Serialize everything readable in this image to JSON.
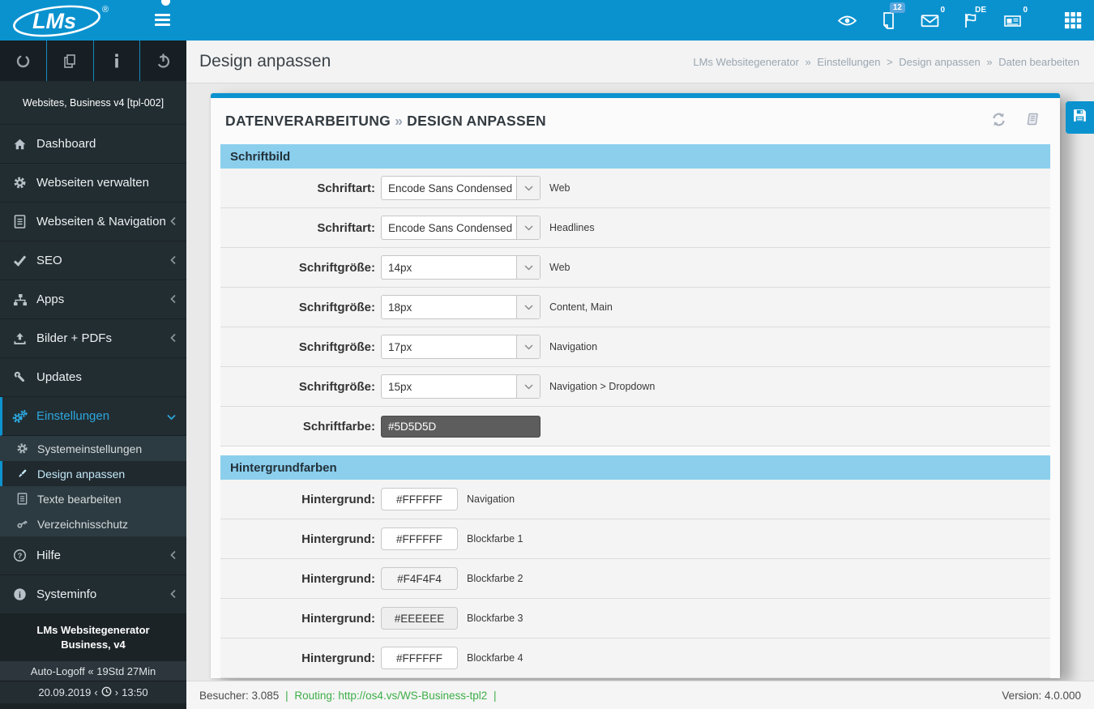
{
  "colors": {
    "accent": "#0a92cf",
    "section_header": "#8bcfed",
    "routing_green": "#3cae47",
    "badge_blue": "#58a7de"
  },
  "navbar": {
    "logo_text": "LMs",
    "logo_reg": "®",
    "preview_badge": "12",
    "mail_count": "0",
    "locale": "DE",
    "news_count": "0"
  },
  "sidebar": {
    "site_label": "Websites, Business v4 [tpl-002]",
    "items": [
      {
        "label": "Dashboard"
      },
      {
        "label": "Webseiten verwalten"
      },
      {
        "label": "Webseiten & Navigation"
      },
      {
        "label": "SEO"
      },
      {
        "label": "Apps"
      },
      {
        "label": "Bilder + PDFs"
      },
      {
        "label": "Updates"
      },
      {
        "label": "Einstellungen"
      },
      {
        "label": "Hilfe"
      },
      {
        "label": "Systeminfo"
      }
    ],
    "settings_submenu": [
      {
        "label": "Systemeinstellungen"
      },
      {
        "label": "Design anpassen"
      },
      {
        "label": "Texte bearbeiten"
      },
      {
        "label": "Verzeichnisschutz"
      }
    ],
    "footer": {
      "line1": "LMs Websitegenerator",
      "line2": "Business, v4",
      "logoff": "Auto-Logoff « 19Std 27Min",
      "date": "20.09.2019",
      "ldec": "‹",
      "rdec": "›",
      "time": "13:50"
    }
  },
  "header": {
    "title": "Design anpassen",
    "breadcrumb": {
      "i0": "LMs Websitegenerator",
      "s0": "»",
      "i1": "Einstellungen",
      "s1": ">",
      "i2": "Design anpassen",
      "s2": "»",
      "i3": "Daten bearbeiten"
    }
  },
  "panel": {
    "heading_part1": "DATENVERARBEITUNG",
    "heading_sep": "»",
    "heading_part2": "DESIGN ANPASSEN",
    "sections": [
      {
        "title": "Schriftbild",
        "rows": [
          {
            "label": "Schriftart:",
            "control": "select",
            "value": "Encode Sans Condensed",
            "note": "Web"
          },
          {
            "label": "Schriftart:",
            "control": "select",
            "value": "Encode Sans Condensed",
            "note": "Headlines"
          },
          {
            "label": "Schriftgröße:",
            "control": "select",
            "value": "14px",
            "note": "Web"
          },
          {
            "label": "Schriftgröße:",
            "control": "select",
            "value": "18px",
            "note": "Content, Main"
          },
          {
            "label": "Schriftgröße:",
            "control": "select",
            "value": "17px",
            "note": "Navigation"
          },
          {
            "label": "Schriftgröße:",
            "control": "select",
            "value": "15px",
            "note": "Navigation > Dropdown"
          },
          {
            "label": "Schriftfarbe:",
            "control": "color",
            "value": "#5D5D5D",
            "note": ""
          }
        ]
      },
      {
        "title": "Hintergrundfarben",
        "rows": [
          {
            "label": "Hintergrund:",
            "control": "color",
            "value": "#FFFFFF",
            "note": "Navigation"
          },
          {
            "label": "Hintergrund:",
            "control": "color",
            "value": "#FFFFFF",
            "note": "Blockfarbe 1"
          },
          {
            "label": "Hintergrund:",
            "control": "color",
            "value": "#F4F4F4",
            "note": "Blockfarbe 2"
          },
          {
            "label": "Hintergrund:",
            "control": "color",
            "value": "#EEEEEE",
            "note": "Blockfarbe 3"
          },
          {
            "label": "Hintergrund:",
            "control": "color",
            "value": "#FFFFFF",
            "note": "Blockfarbe 4"
          }
        ]
      }
    ]
  },
  "footer": {
    "visitors": "Besucher: 3.085",
    "pipe": "|",
    "routing": "Routing: http://os4.vs/WS-Business-tpl2",
    "version": "Version: 4.0.000"
  }
}
